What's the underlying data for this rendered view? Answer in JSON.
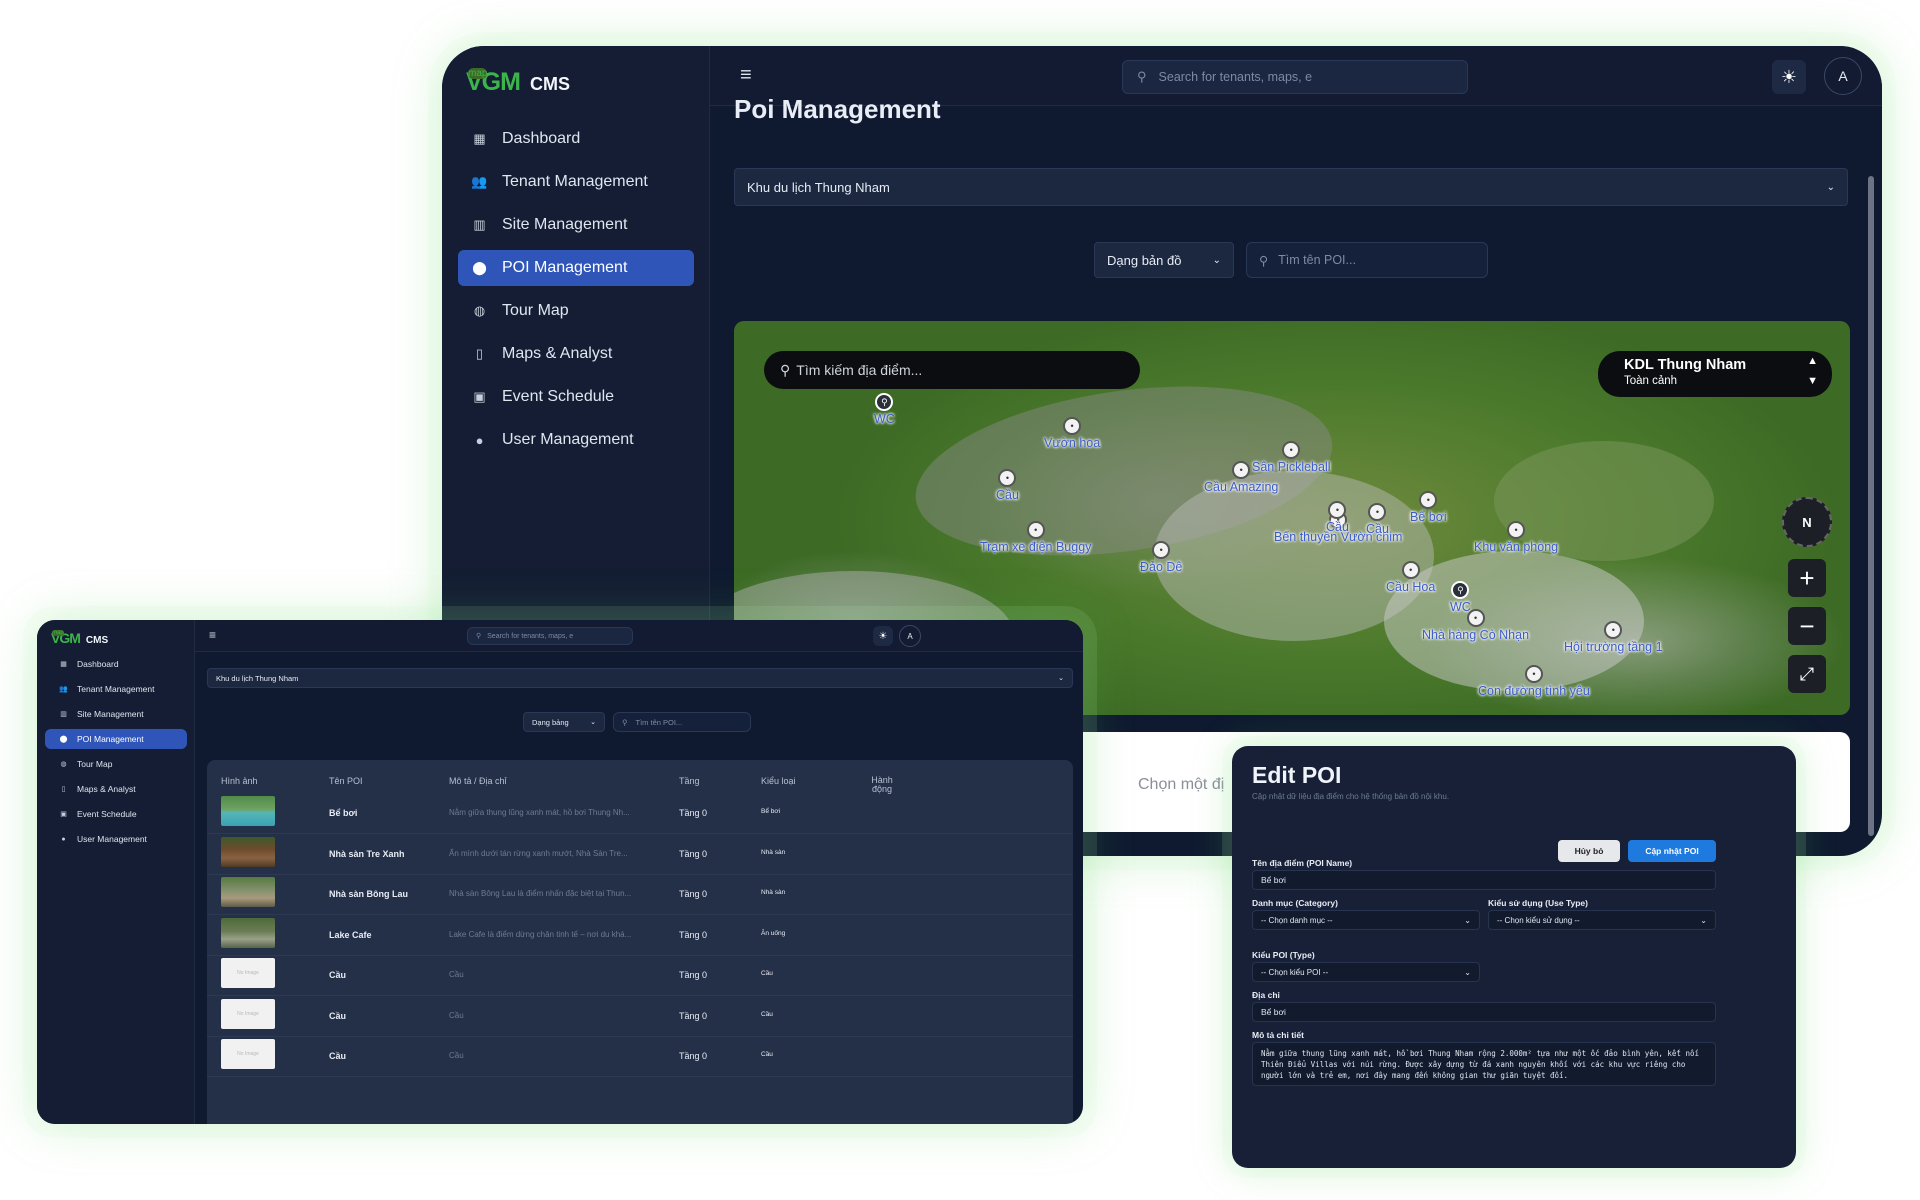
{
  "brand": {
    "vgm": "VGM",
    "map": "map",
    "cms": "CMS"
  },
  "nav": [
    {
      "label": "Dashboard",
      "icon": "grid-icon"
    },
    {
      "label": "Tenant Management",
      "icon": "users-icon"
    },
    {
      "label": "Site Management",
      "icon": "building-icon"
    },
    {
      "label": "POI Management",
      "icon": "pin-icon",
      "active": true
    },
    {
      "label": "Tour Map",
      "icon": "compass-icon"
    },
    {
      "label": "Maps & Analyst",
      "icon": "map-icon"
    },
    {
      "label": "Event Schedule",
      "icon": "calendar-icon"
    },
    {
      "label": "User Management",
      "icon": "user-icon"
    }
  ],
  "topbar": {
    "search_placeholder": "Search for tenants, maps, e",
    "avatar": "A"
  },
  "page": {
    "title": "Poi Management",
    "site_select": "Khu du lịch Thung Nham",
    "view_select_map": "Dạng bản đồ",
    "view_select_table": "Dạng bảng",
    "poi_search_placeholder": "Tìm tên POI...",
    "choose_prompt": "Chọn một đị"
  },
  "map": {
    "search_placeholder": "Tìm kiếm địa điểm...",
    "panel_title": "KDL Thung Nham",
    "panel_sub": "Toàn cảnh",
    "compass": "N",
    "zoom_in": "+",
    "zoom_out": "−",
    "pois": [
      "WC",
      "Vườn hoa",
      "Cầu",
      "Trạm xe điện Buggy",
      "Đảo Dê",
      "Sân Pickleball",
      "Cầu Amazing",
      "Bến thuyền Vườn chim",
      "Cầu",
      "Cầu",
      "Bể bơi",
      "Khu văn phòng",
      "Cầu Hoa",
      "WC",
      "Nhà hàng Cò Nhạn",
      "Hội trường tầng 1",
      "Con đường tình yêu"
    ]
  },
  "table": {
    "headers": [
      "Hình ảnh",
      "Tên POI",
      "Mô tả / Địa chỉ",
      "Tầng",
      "Kiểu loại",
      "Hành động"
    ],
    "rows": [
      {
        "name": "Bể bơi",
        "desc": "Nằm giữa thung lũng xanh mát, hồ bơi Thung Nh...",
        "floor": "Tầng 0",
        "type": "Bể bơi",
        "img": "pool"
      },
      {
        "name": "Nhà sàn Tre Xanh",
        "desc": "Ẩn mình dưới tán rừng xanh mướt, Nhà Sàn Tre...",
        "floor": "Tầng 0",
        "type": "Nhà sàn",
        "img": "house"
      },
      {
        "name": "Nhà sàn Bông Lau",
        "desc": "Nhà sàn Bông Lau là điểm nhấn đặc biệt tại Thun...",
        "floor": "Tầng 0",
        "type": "Nhà sàn",
        "img": "house2"
      },
      {
        "name": "Lake Cafe",
        "desc": "Lake Cafe là điểm dừng chân tinh tế – nơi du khá...",
        "floor": "Tầng 0",
        "type": "Ăn uống",
        "img": "cafe"
      },
      {
        "name": "Cầu",
        "desc": "Cầu",
        "floor": "Tầng 0",
        "type": "Cầu",
        "img": "none"
      },
      {
        "name": "Cầu",
        "desc": "Cầu",
        "floor": "Tầng 0",
        "type": "Cầu",
        "img": "none"
      },
      {
        "name": "Cầu",
        "desc": "Cầu",
        "floor": "Tầng 0",
        "type": "Cầu",
        "img": "none"
      }
    ],
    "no_image": "No Image"
  },
  "edit": {
    "title": "Edit POI",
    "subtitle": "Cập nhật dữ liệu địa điểm cho hệ thống bản đồ nội khu.",
    "cancel": "Hủy bỏ",
    "submit": "Cập nhật POI",
    "name_label": "Tên địa điểm (POI Name)",
    "name_value": "Bể bơi",
    "category_label": "Danh mục (Category)",
    "category_value": "-- Chọn danh mục --",
    "usetype_label": "Kiểu sử dụng (Use Type)",
    "usetype_value": "-- Chọn kiểu sử dụng --",
    "type_label": "Kiểu POI (Type)",
    "type_value": "-- Chọn kiểu POI --",
    "address_label": "Địa chỉ",
    "address_value": "Bể bơi",
    "desc_label": "Mô tả chi tiết",
    "desc_value": "Nằm giữa thung lũng xanh mát, hồ bơi Thung Nham rộng 2.000m² tựa như một ốc đảo bình yên, kết nối Thiên Điểu Villas với núi rừng. Được xây dựng từ đá xanh nguyên khối với các khu vực riêng cho người lớn và trẻ em, nơi đây mang đến không gian thư giãn tuyệt đối."
  },
  "colors": {
    "bg": "#0f1a30",
    "sidebar": "#141d33",
    "active": "#2f55b8",
    "accent_green": "#3cb44b",
    "primary_button": "#1f7ae0"
  }
}
